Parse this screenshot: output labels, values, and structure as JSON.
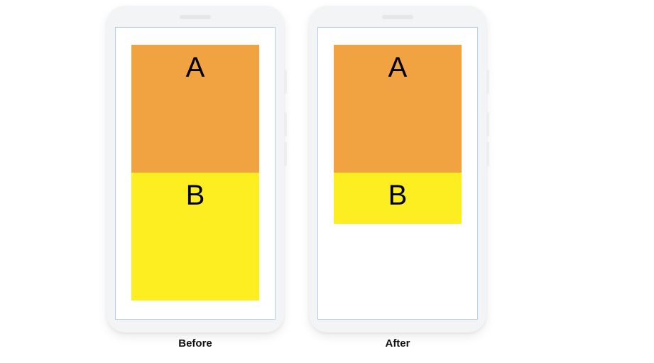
{
  "diagram": {
    "before_caption": "Before",
    "after_caption": "After",
    "block_a_label": "A",
    "block_b_label": "B",
    "colors": {
      "block_a": "#f2a341",
      "block_b": "#fcee21",
      "phone_body": "#f3f4f5",
      "screen_border": "#b6cdea"
    },
    "layout": {
      "before": {
        "a_height": 180,
        "b_height": 180
      },
      "after": {
        "a_height": 180,
        "b_height": 72
      }
    }
  }
}
